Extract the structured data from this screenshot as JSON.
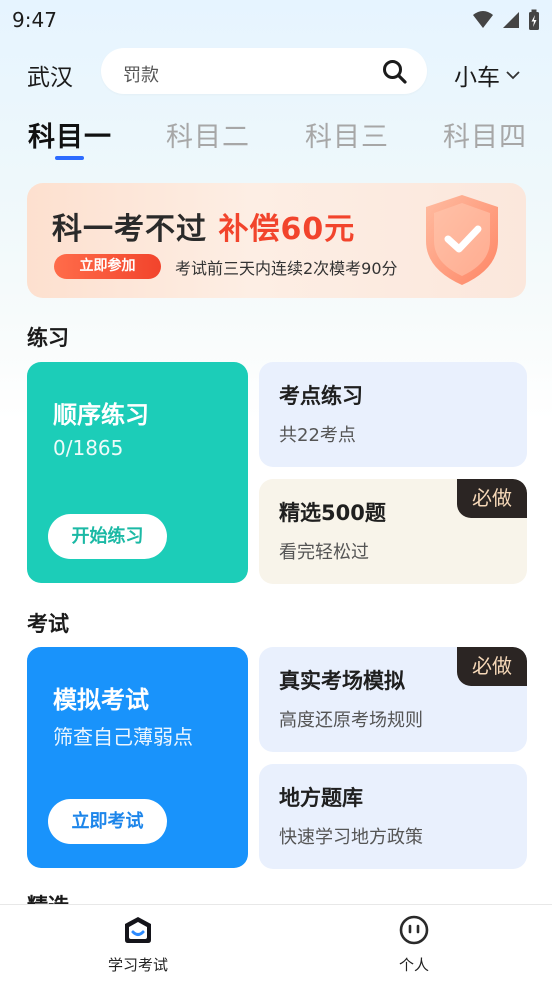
{
  "status_bar": {
    "time": "9:47"
  },
  "header": {
    "city": "武汉",
    "search_placeholder": "罚款",
    "vehicle": "小车"
  },
  "subject_tabs": [
    {
      "label": "科目一",
      "active": true
    },
    {
      "label": "科目二",
      "active": false
    },
    {
      "label": "科目三",
      "active": false
    },
    {
      "label": "科目四",
      "active": false
    }
  ],
  "promo": {
    "title": "科一考不过",
    "highlight": "补偿60元",
    "button": "立即参加",
    "description": "考试前三天内连续2次模考90分"
  },
  "practice": {
    "section_title": "练习",
    "main_card": {
      "title": "顺序练习",
      "progress": "0/1865",
      "button": "开始练习"
    },
    "card_points": {
      "title": "考点练习",
      "subtitle": "共22考点"
    },
    "card_selected": {
      "title": "精选500题",
      "subtitle": "看完轻松过",
      "badge": "必做"
    }
  },
  "exam": {
    "section_title": "考试",
    "main_card": {
      "title": "模拟考试",
      "subtitle": "筛查自己薄弱点",
      "button": "立即考试"
    },
    "card_real": {
      "title": "真实考场模拟",
      "subtitle": "高度还原考场规则",
      "badge": "必做"
    },
    "card_local": {
      "title": "地方题库",
      "subtitle": "快速学习地方政策"
    }
  },
  "next_section_title": "精选",
  "bottom_nav": {
    "study": "学习考试",
    "profile": "个人"
  },
  "colors": {
    "accent_blue": "#2d6bff",
    "practice_green": "#1ccdb8",
    "exam_blue": "#1993fb",
    "promo_red": "#f2442c",
    "badge_dark": "#2b2523"
  }
}
